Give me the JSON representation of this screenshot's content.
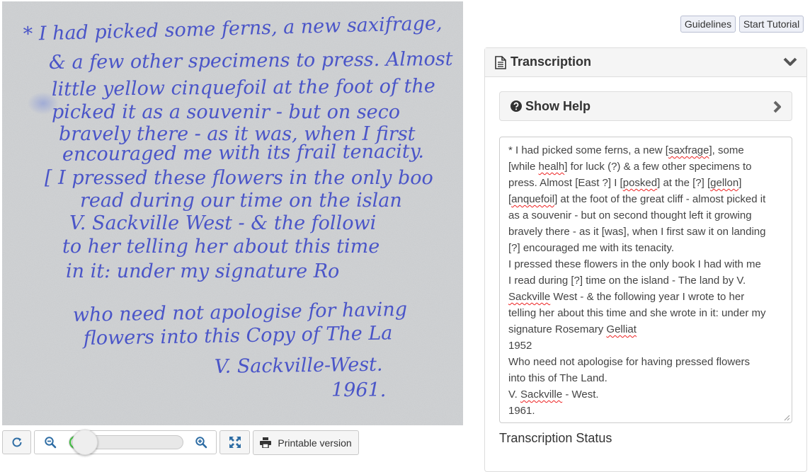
{
  "manuscript": {
    "lines": [
      "* I had picked some ferns, a new saxifrage,",
      "& a few other specimens to press. Almost",
      "little yellow cinquefoil at the foot of the",
      "picked it as a souvenir - but on seco",
      "bravely there - as it was, when I first",
      "encouraged me with its frail tenacity.",
      "[ I pressed these flowers in the only boo",
      "read during our time on the islan",
      "V. Sackville West - & the followi",
      "to her telling her about this time",
      "in it:  under my signature Ro",
      "who need not apologise for having",
      "flowers into this Copy of The La",
      "V. Sackville-West.",
      "1961."
    ]
  },
  "toolbar": {
    "reset_icon": "refresh-icon",
    "zoom_out_icon": "zoom-out-icon",
    "zoom_in_icon": "zoom-in-icon",
    "fullscreen_icon": "fullscreen-icon",
    "zoom_level": 0.14,
    "printable_label": "Printable version",
    "printable_icon": "printer-icon"
  },
  "header_buttons": {
    "guidelines": "Guidelines",
    "start_tutorial": "Start Tutorial"
  },
  "transcription_panel": {
    "title": "Transcription",
    "title_icon": "document-icon",
    "collapse_icon": "chevron-down-icon",
    "help": {
      "title": "Show Help",
      "icon": "question-circle-icon",
      "expand_icon": "chevron-right-icon"
    },
    "text_lines": [
      [
        {
          "t": "* I had picked some ferns, a new ["
        },
        {
          "t": "saxfrage",
          "sp": true
        },
        {
          "t": "], some"
        }
      ],
      [
        {
          "t": "[while "
        },
        {
          "t": "healh",
          "sp": true
        },
        {
          "t": "] for luck (?) & a few other specimens to"
        }
      ],
      [
        {
          "t": "press. Almost [East ?] I ["
        },
        {
          "t": "posked",
          "sp": true
        },
        {
          "t": "] at the [?] ["
        },
        {
          "t": "gellon",
          "sp": true
        },
        {
          "t": "]"
        }
      ],
      [
        {
          "t": "["
        },
        {
          "t": "anquefoil",
          "sp": true
        },
        {
          "t": "] at the foot of the great cliff - almost picked it"
        }
      ],
      [
        {
          "t": "as a souvenir - but on second thought left it growing"
        }
      ],
      [
        {
          "t": "bravely there - as it [was], when I first saw it on landing"
        }
      ],
      [
        {
          "t": "[?] encouraged me with its tenacity."
        }
      ],
      [
        {
          "t": "I pressed these flowers in the only book I had with me"
        }
      ],
      [
        {
          "t": "I read during [?] time on the island - The land by V."
        }
      ],
      [
        {
          "t": "Sackville",
          "sp": true
        },
        {
          "t": " West - & the following year I wrote to her"
        }
      ],
      [
        {
          "t": "telling her about this time and she wrote in it: under my"
        }
      ],
      [
        {
          "t": "signature Rosemary "
        },
        {
          "t": "Gelliat",
          "sp": true
        }
      ],
      [
        {
          "t": "1952"
        }
      ],
      [
        {
          "t": "Who need not apologise for having pressed flowers"
        }
      ],
      [
        {
          "t": "into this of The Land."
        }
      ],
      [
        {
          "t": "V. "
        },
        {
          "t": "Sackville",
          "sp": true
        },
        {
          "t": " - West."
        }
      ],
      [
        {
          "t": "1961."
        }
      ]
    ],
    "status_label": "Transcription Status"
  },
  "colors": {
    "ink": "#4a55c8",
    "paper": "#c9cbcd",
    "slider_fill": "#3ec43e",
    "spellcheck": "#e22222"
  }
}
